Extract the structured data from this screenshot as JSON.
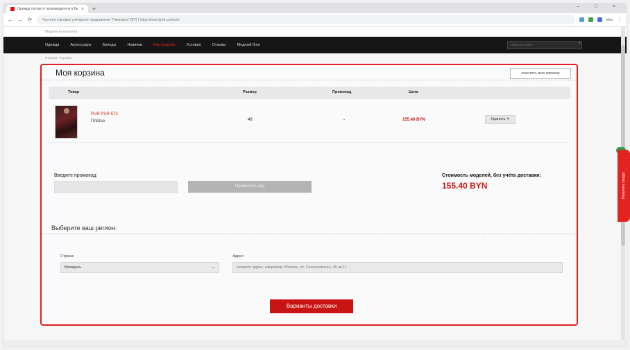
{
  "browser": {
    "tab_title": "Одежда оптом от производителя в Беларуси",
    "tab_close": "×",
    "new_tab": "+",
    "window_controls": "– □ ×",
    "url": "Частное торговое унитарное предприятие \"Пекалина\" [BY] | https://www.bj-bt.com/cart",
    "account": "Ино"
  },
  "site": {
    "top_note": "Модели из каталога",
    "nav": [
      "Одежда",
      "Аксессуары",
      "Бренды",
      "Новинки",
      "Распродажа",
      "Условия",
      "Отзывы",
      "Модный блог"
    ],
    "search_placeholder": "Поиск по сайту",
    "breadcrumb": "Главная › Корзина"
  },
  "cart": {
    "title": "Моя корзина",
    "clear_label": "очистить всю корзину",
    "columns": {
      "product": "Товар",
      "size": "Размер",
      "promo": "Промокод",
      "price": "Цена"
    },
    "items": [
      {
        "code": "PUR PUR 573",
        "name": "Платье",
        "size": "48",
        "promo": "-",
        "price": "155.40 BYN",
        "delete_label": "Удалить"
      }
    ],
    "promo_label": "Введите промокод:",
    "promo_value": "",
    "apply_label": "Применить код",
    "total_label": "Стоимость моделей, без учёта доставки:",
    "total_value": "155.40 BYN",
    "region_title": "Выберите ваш регион:",
    "country_label": "Страна:",
    "country_value": "Беларусь",
    "address_label": "Адрес:",
    "address_placeholder": "Укажите адрес, например: Москва, ул. Селезневская, 45 кв.11",
    "delivery_button": "Варианты доставки"
  },
  "sidebar_widget": {
    "label": "Получить скидку"
  },
  "colors": {
    "accent": "#e02020",
    "price": "#c31515",
    "nav_bg": "#161616"
  }
}
